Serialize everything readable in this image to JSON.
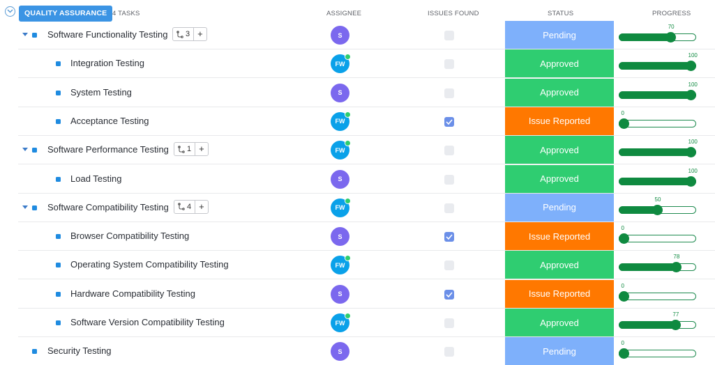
{
  "group": {
    "label": "QUALITY ASSURANCE",
    "task_count": "4 TASKS"
  },
  "columns": {
    "assignee": "ASSIGNEE",
    "issues": "ISSUES FOUND",
    "status": "STATUS",
    "progress": "PROGRESS"
  },
  "colors": {
    "pending": "#7eb0fb",
    "approved": "#2fcd71",
    "issue_reported": "#ff7800"
  },
  "rows": [
    {
      "name": "Software Functionality Testing",
      "level": 0,
      "expanded": true,
      "subtasks": "3",
      "assignee": "S",
      "assignee_online": false,
      "issue": false,
      "status": "Pending",
      "progress": 70
    },
    {
      "name": "Integration Testing",
      "level": 1,
      "assignee": "FW",
      "assignee_online": true,
      "issue": false,
      "status": "Approved",
      "progress": 100
    },
    {
      "name": "System Testing",
      "level": 1,
      "assignee": "S",
      "assignee_online": false,
      "issue": false,
      "status": "Approved",
      "progress": 100
    },
    {
      "name": "Acceptance Testing",
      "level": 1,
      "assignee": "FW",
      "assignee_online": true,
      "issue": true,
      "status": "Issue Reported",
      "progress": 0
    },
    {
      "name": "Software Performance Testing",
      "level": 0,
      "expanded": true,
      "subtasks": "1",
      "assignee": "FW",
      "assignee_online": true,
      "issue": false,
      "status": "Approved",
      "progress": 100
    },
    {
      "name": "Load Testing",
      "level": 1,
      "assignee": "S",
      "assignee_online": false,
      "issue": false,
      "status": "Approved",
      "progress": 100
    },
    {
      "name": "Software Compatibility Testing",
      "level": 0,
      "expanded": true,
      "subtasks": "4",
      "assignee": "FW",
      "assignee_online": true,
      "issue": false,
      "status": "Pending",
      "progress": 50
    },
    {
      "name": "Browser Compatibility Testing",
      "level": 1,
      "assignee": "S",
      "assignee_online": false,
      "issue": true,
      "status": "Issue Reported",
      "progress": 0
    },
    {
      "name": "Operating System Compatibility Testing",
      "level": 1,
      "assignee": "FW",
      "assignee_online": true,
      "issue": false,
      "status": "Approved",
      "progress": 78
    },
    {
      "name": "Hardware Compatibility Testing",
      "level": 1,
      "assignee": "S",
      "assignee_online": false,
      "issue": true,
      "status": "Issue Reported",
      "progress": 0
    },
    {
      "name": "Software Version Compatibility Testing",
      "level": 1,
      "assignee": "FW",
      "assignee_online": true,
      "issue": false,
      "status": "Approved",
      "progress": 77
    },
    {
      "name": "Security Testing",
      "level": 0,
      "expanded": false,
      "assignee": "S",
      "assignee_online": false,
      "issue": false,
      "status": "Pending",
      "progress": 0
    }
  ]
}
